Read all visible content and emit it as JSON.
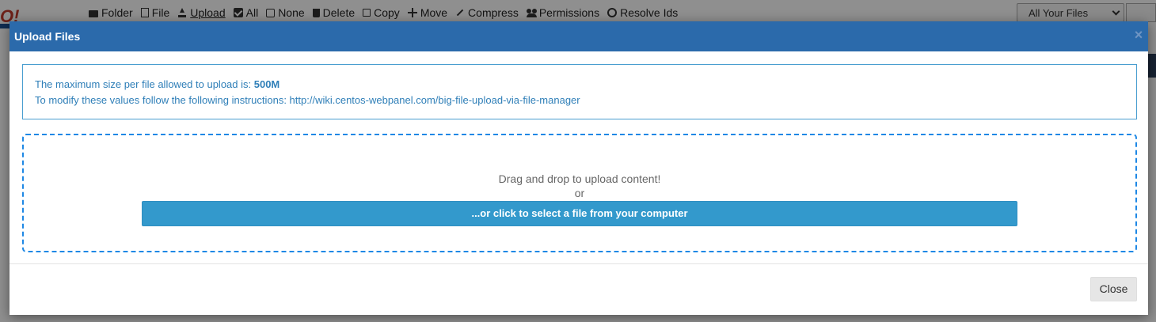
{
  "background": {
    "logo": "O!",
    "toolbar": {
      "items": [
        {
          "label": "Folder",
          "icon": "folder-icon"
        },
        {
          "label": "File",
          "icon": "file-icon"
        },
        {
          "label": "Upload",
          "icon": "upload-icon"
        },
        {
          "label": "All",
          "icon": "checkbox-checked-icon"
        },
        {
          "label": "None",
          "icon": "checkbox-empty-icon"
        },
        {
          "label": "Delete",
          "icon": "trash-icon"
        },
        {
          "label": "Copy",
          "icon": "copy-icon"
        },
        {
          "label": "Move",
          "icon": "move-icon"
        },
        {
          "label": "Compress",
          "icon": "compress-icon"
        },
        {
          "label": "Permissions",
          "icon": "users-icon"
        },
        {
          "label": "Resolve Ids",
          "icon": "circle-icon"
        }
      ]
    },
    "file_filter": {
      "selected": "All Your Files"
    }
  },
  "modal": {
    "title": "Upload Files",
    "info": {
      "max_size_prefix": "The maximum size per file allowed to upload is: ",
      "max_size_value": "500M",
      "instructions_prefix": "To modify these values follow the following instructions: ",
      "instructions_link": "http://wiki.centos-webpanel.com/big-file-upload-via-file-manager"
    },
    "drop_zone": {
      "drag_text": "Drag and drop to upload content!",
      "or_text": "or",
      "select_button": "...or click to select a file from your computer"
    },
    "close_button": "Close",
    "close_icon": "×"
  },
  "colors": {
    "header": "#2b6aab",
    "accent": "#3399cc",
    "dashed_border": "#1e88e5",
    "info_text": "#2f7fb8"
  }
}
